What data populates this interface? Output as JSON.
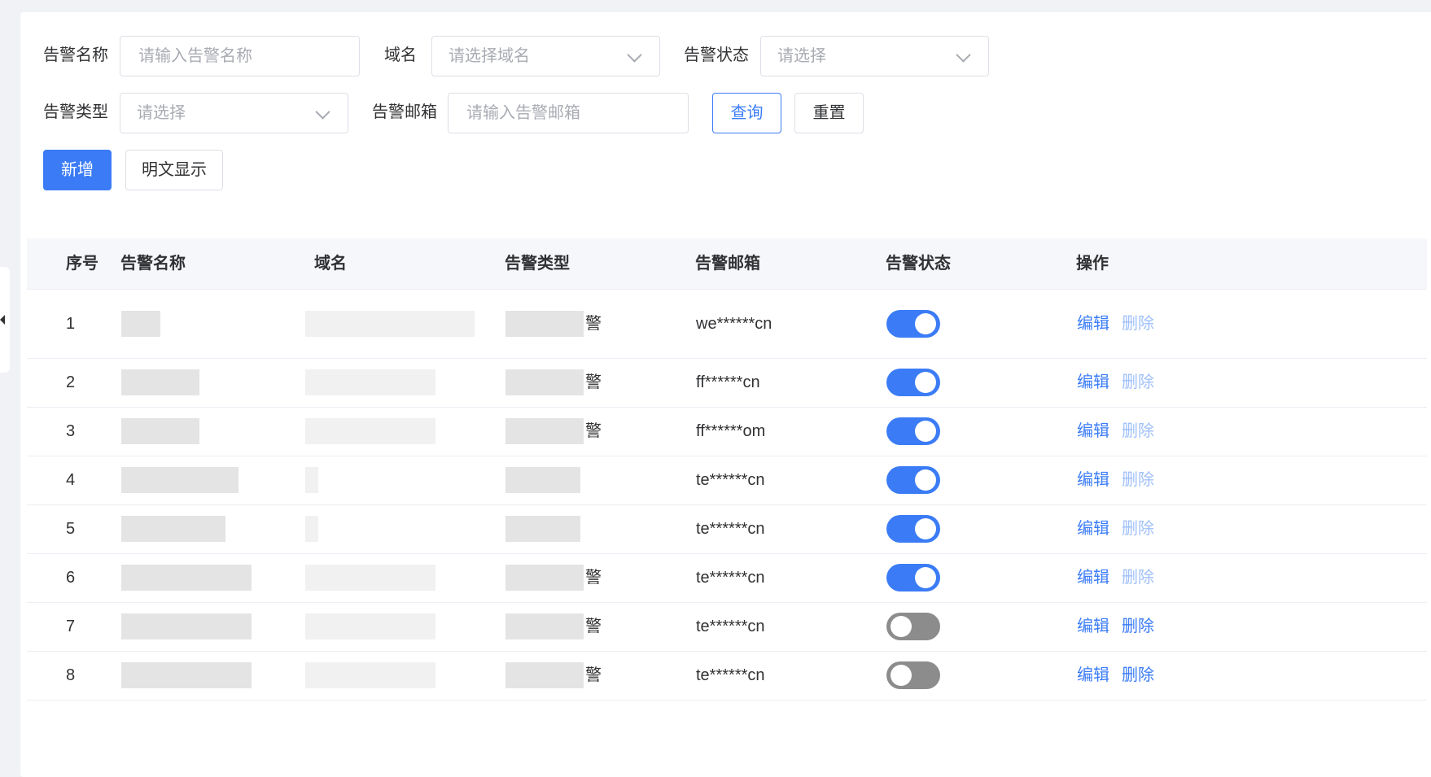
{
  "filters": {
    "name_label": "告警名称",
    "name_placeholder": "请输入告警名称",
    "domain_label": "域名",
    "domain_placeholder": "请选择域名",
    "status_label": "告警状态",
    "status_placeholder": "请选择",
    "type_label": "告警类型",
    "type_placeholder": "请选择",
    "email_label": "告警邮箱",
    "email_placeholder": "请输入告警邮箱",
    "query_button": "查询",
    "reset_button": "重置"
  },
  "actions": {
    "add_button": "新增",
    "plaintext_button": "明文显示"
  },
  "table": {
    "columns": [
      "序号",
      "告警名称",
      "域名",
      "告警类型",
      "告警邮箱",
      "告警状态",
      "操作"
    ],
    "rows": [
      {
        "index": "1",
        "type_suffix": "警",
        "email": "we******cn",
        "status_on": true,
        "edit": "编辑",
        "delete": "删除",
        "delete_disabled": true
      },
      {
        "index": "2",
        "type_suffix": "警",
        "email": "ff******cn",
        "status_on": true,
        "edit": "编辑",
        "delete": "删除",
        "delete_disabled": true
      },
      {
        "index": "3",
        "type_suffix": "警",
        "email": "ff******om",
        "status_on": true,
        "edit": "编辑",
        "delete": "删除",
        "delete_disabled": true
      },
      {
        "index": "4",
        "type_suffix": "",
        "email": "te******cn",
        "status_on": true,
        "edit": "编辑",
        "delete": "删除",
        "delete_disabled": true
      },
      {
        "index": "5",
        "type_suffix": "",
        "email": "te******cn",
        "status_on": true,
        "edit": "编辑",
        "delete": "删除",
        "delete_disabled": true
      },
      {
        "index": "6",
        "type_suffix": "警",
        "email": "te******cn",
        "status_on": true,
        "edit": "编辑",
        "delete": "删除",
        "delete_disabled": true
      },
      {
        "index": "7",
        "type_suffix": "警",
        "email": "te******cn",
        "status_on": false,
        "edit": "编辑",
        "delete": "删除",
        "delete_disabled": false
      },
      {
        "index": "8",
        "type_suffix": "警",
        "email": "te******cn",
        "status_on": false,
        "edit": "编辑",
        "delete": "删除",
        "delete_disabled": false
      }
    ]
  },
  "colors": {
    "primary": "#3b7cf6",
    "switch_off": "#8c8c8c",
    "delete_disabled": "#a0c0fa"
  }
}
